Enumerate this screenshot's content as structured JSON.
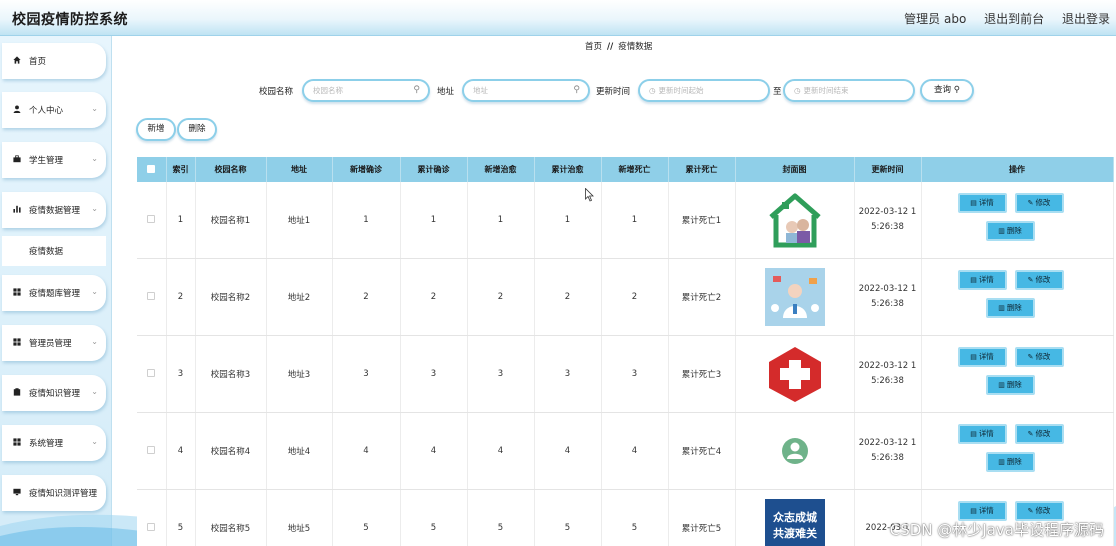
{
  "app": {
    "title": "校园疫情防控系统",
    "admin": "管理员 abo",
    "back_to_front": "退出到前台",
    "logout": "退出登录"
  },
  "sidebar": {
    "items": [
      {
        "label": "首页",
        "icon": "home-icon"
      },
      {
        "label": "个人中心",
        "icon": "user-icon"
      },
      {
        "label": "学生管理",
        "icon": "briefcase-icon"
      },
      {
        "label": "疫情数据管理",
        "icon": "bar-chart-icon"
      },
      {
        "label": "疫情数据",
        "icon": ""
      },
      {
        "label": "疫情题库管理",
        "icon": "grid-icon"
      },
      {
        "label": "管理员管理",
        "icon": "grid-icon"
      },
      {
        "label": "疫情知识管理",
        "icon": "clipboard-icon"
      },
      {
        "label": "系统管理",
        "icon": "grid-icon"
      },
      {
        "label": "疫情知识测评管理",
        "icon": "monitor-icon"
      }
    ]
  },
  "breadcrumb": {
    "home": "首页",
    "sep": "//",
    "current": "疫情数据"
  },
  "search": {
    "school_label": "校园名称",
    "school_placeholder": "校园名称",
    "address_label": "地址",
    "address_placeholder": "地址",
    "time_label": "更新时间",
    "time_start_placeholder": "更新时间起始",
    "time_to": "至",
    "time_end_placeholder": "更新时间结束",
    "query_label": "查询"
  },
  "actions": {
    "add": "新增",
    "delete": "删除"
  },
  "table": {
    "headers": [
      "索引",
      "校园名称",
      "地址",
      "新增确诊",
      "累计确诊",
      "新增治愈",
      "累计治愈",
      "新增死亡",
      "累计死亡",
      "封面图",
      "更新时间",
      "操作"
    ],
    "rows": [
      {
        "index": "1",
        "school": "校园名称1",
        "address": "地址1",
        "new_confirmed": "1",
        "total_confirmed": "1",
        "new_cured": "1",
        "total_cured": "1",
        "new_death": "1",
        "total_death": "累计死亡1",
        "time_line1": "2022-03-12 1",
        "time_line2": "5:26:38",
        "cover": "house-doctor-icon"
      },
      {
        "index": "2",
        "school": "校园名称2",
        "address": "地址2",
        "new_confirmed": "2",
        "total_confirmed": "2",
        "new_cured": "2",
        "total_cured": "2",
        "new_death": "2",
        "total_death": "累计死亡2",
        "time_line1": "2022-03-12 1",
        "time_line2": "5:26:38",
        "cover": "doctor-poster-icon"
      },
      {
        "index": "3",
        "school": "校园名称3",
        "address": "地址3",
        "new_confirmed": "3",
        "total_confirmed": "3",
        "new_cured": "3",
        "total_cured": "3",
        "new_death": "3",
        "total_death": "累计死亡3",
        "time_line1": "2022-03-12 1",
        "time_line2": "5:26:38",
        "cover": "red-cross-icon"
      },
      {
        "index": "4",
        "school": "校园名称4",
        "address": "地址4",
        "new_confirmed": "4",
        "total_confirmed": "4",
        "new_cured": "4",
        "total_cured": "4",
        "new_death": "4",
        "total_death": "累计死亡4",
        "time_line1": "2022-03-12 1",
        "time_line2": "5:26:38",
        "cover": "nurse-badge-icon"
      },
      {
        "index": "5",
        "school": "校园名称5",
        "address": "地址5",
        "new_confirmed": "5",
        "total_confirmed": "5",
        "new_cured": "5",
        "total_cured": "5",
        "new_death": "5",
        "total_death": "累计死亡5",
        "time_line1": "2022-03-1",
        "time_line2": "",
        "cover": "slogan-poster-icon",
        "cover_text1": "众志成城",
        "cover_text2": "共渡难关"
      }
    ],
    "op_detail": "详情",
    "op_edit": "修改",
    "op_delete": "删除"
  },
  "watermark": "CSDN @林少Java毕设程序源码",
  "colors": {
    "accent": "#8fcfe8",
    "button": "#46b8e4",
    "border": "#8ccfe9"
  }
}
